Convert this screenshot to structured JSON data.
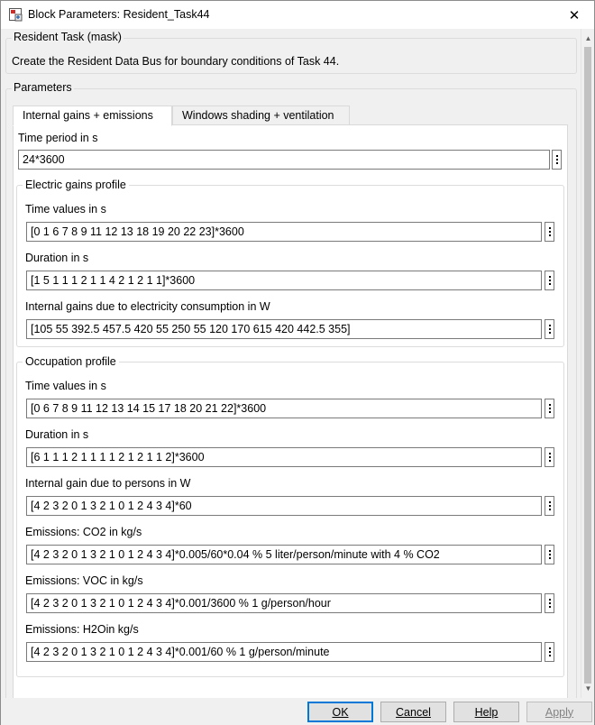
{
  "window": {
    "title": "Block Parameters: Resident_Task44",
    "close_glyph": "✕"
  },
  "mask": {
    "legend": "Resident Task (mask)",
    "description": "Create the Resident Data Bus for boundary conditions of Task 44."
  },
  "parameters": {
    "legend": "Parameters",
    "tabs": [
      {
        "label": "Internal gains + emissions",
        "active": true
      },
      {
        "label": "Windows shading + ventilation",
        "active": false
      }
    ],
    "time_period": {
      "label": "Time period in s",
      "value": "24*3600"
    },
    "electric": {
      "legend": "Electric gains profile",
      "fields": [
        {
          "label": "Time values in s",
          "value": "[0 1 6 7 8 9 11 12 13 18 19 20 22 23]*3600"
        },
        {
          "label": "Duration in s",
          "value": "[1 5 1 1 1 2 1 1 4 2 1 2 1 1]*3600"
        },
        {
          "label": "Internal gains due to electricity consumption in W",
          "value": "[105 55 392.5 457.5 420 55 250 55 120 170 615 420 442.5 355]"
        }
      ]
    },
    "occupation": {
      "legend": "Occupation profile",
      "fields": [
        {
          "label": "Time values in s",
          "value": "[0 6 7 8 9 11 12 13 14 15 17 18 20 21 22]*3600"
        },
        {
          "label": "Duration in s",
          "value": "[6 1 1 1 2 1 1 1 1 2 1 2 1 1 2]*3600"
        },
        {
          "label": "Internal gain due to persons in W",
          "value": "[4 2 3 2 0 1 3 2 1 0 1 2 4 3 4]*60"
        },
        {
          "label": "Emissions: CO2 in kg/s",
          "value": "[4 2 3 2 0 1 3 2 1 0 1 2 4 3 4]*0.005/60*0.04  % 5 liter/person/minute with 4 % CO2"
        },
        {
          "label": "Emissions: VOC in kg/s",
          "value": "[4 2 3 2 0 1 3 2 1 0 1 2 4 3 4]*0.001/3600 % 1 g/person/hour"
        },
        {
          "label": "Emissions: H2Oin kg/s",
          "value": "[4 2 3 2 0 1 3 2 1 0 1 2 4 3 4]*0.001/60 % 1 g/person/minute"
        }
      ]
    }
  },
  "footer": {
    "ok": "OK",
    "cancel": "Cancel",
    "help": "Help",
    "apply": "Apply"
  }
}
